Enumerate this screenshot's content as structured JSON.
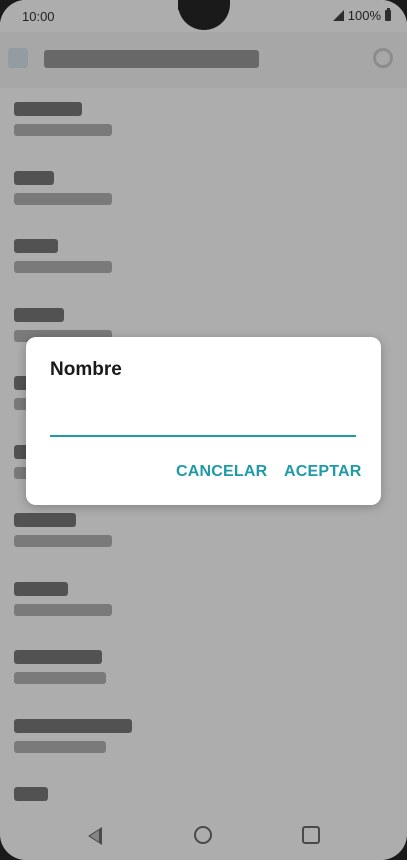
{
  "status_bar": {
    "time": "10:00",
    "battery": "100%"
  },
  "dialog": {
    "title": "Nombre",
    "input_value": "",
    "cancel_label": "CANCELAR",
    "accept_label": "ACEPTAR"
  },
  "colors": {
    "accent": "#1e9aa8",
    "scrim": "rgba(0,0,0,0.32)"
  },
  "icons": [
    "signal-icon",
    "battery-icon",
    "back-icon",
    "search-icon",
    "nav-back-icon",
    "nav-home-icon",
    "nav-recents-icon"
  ]
}
